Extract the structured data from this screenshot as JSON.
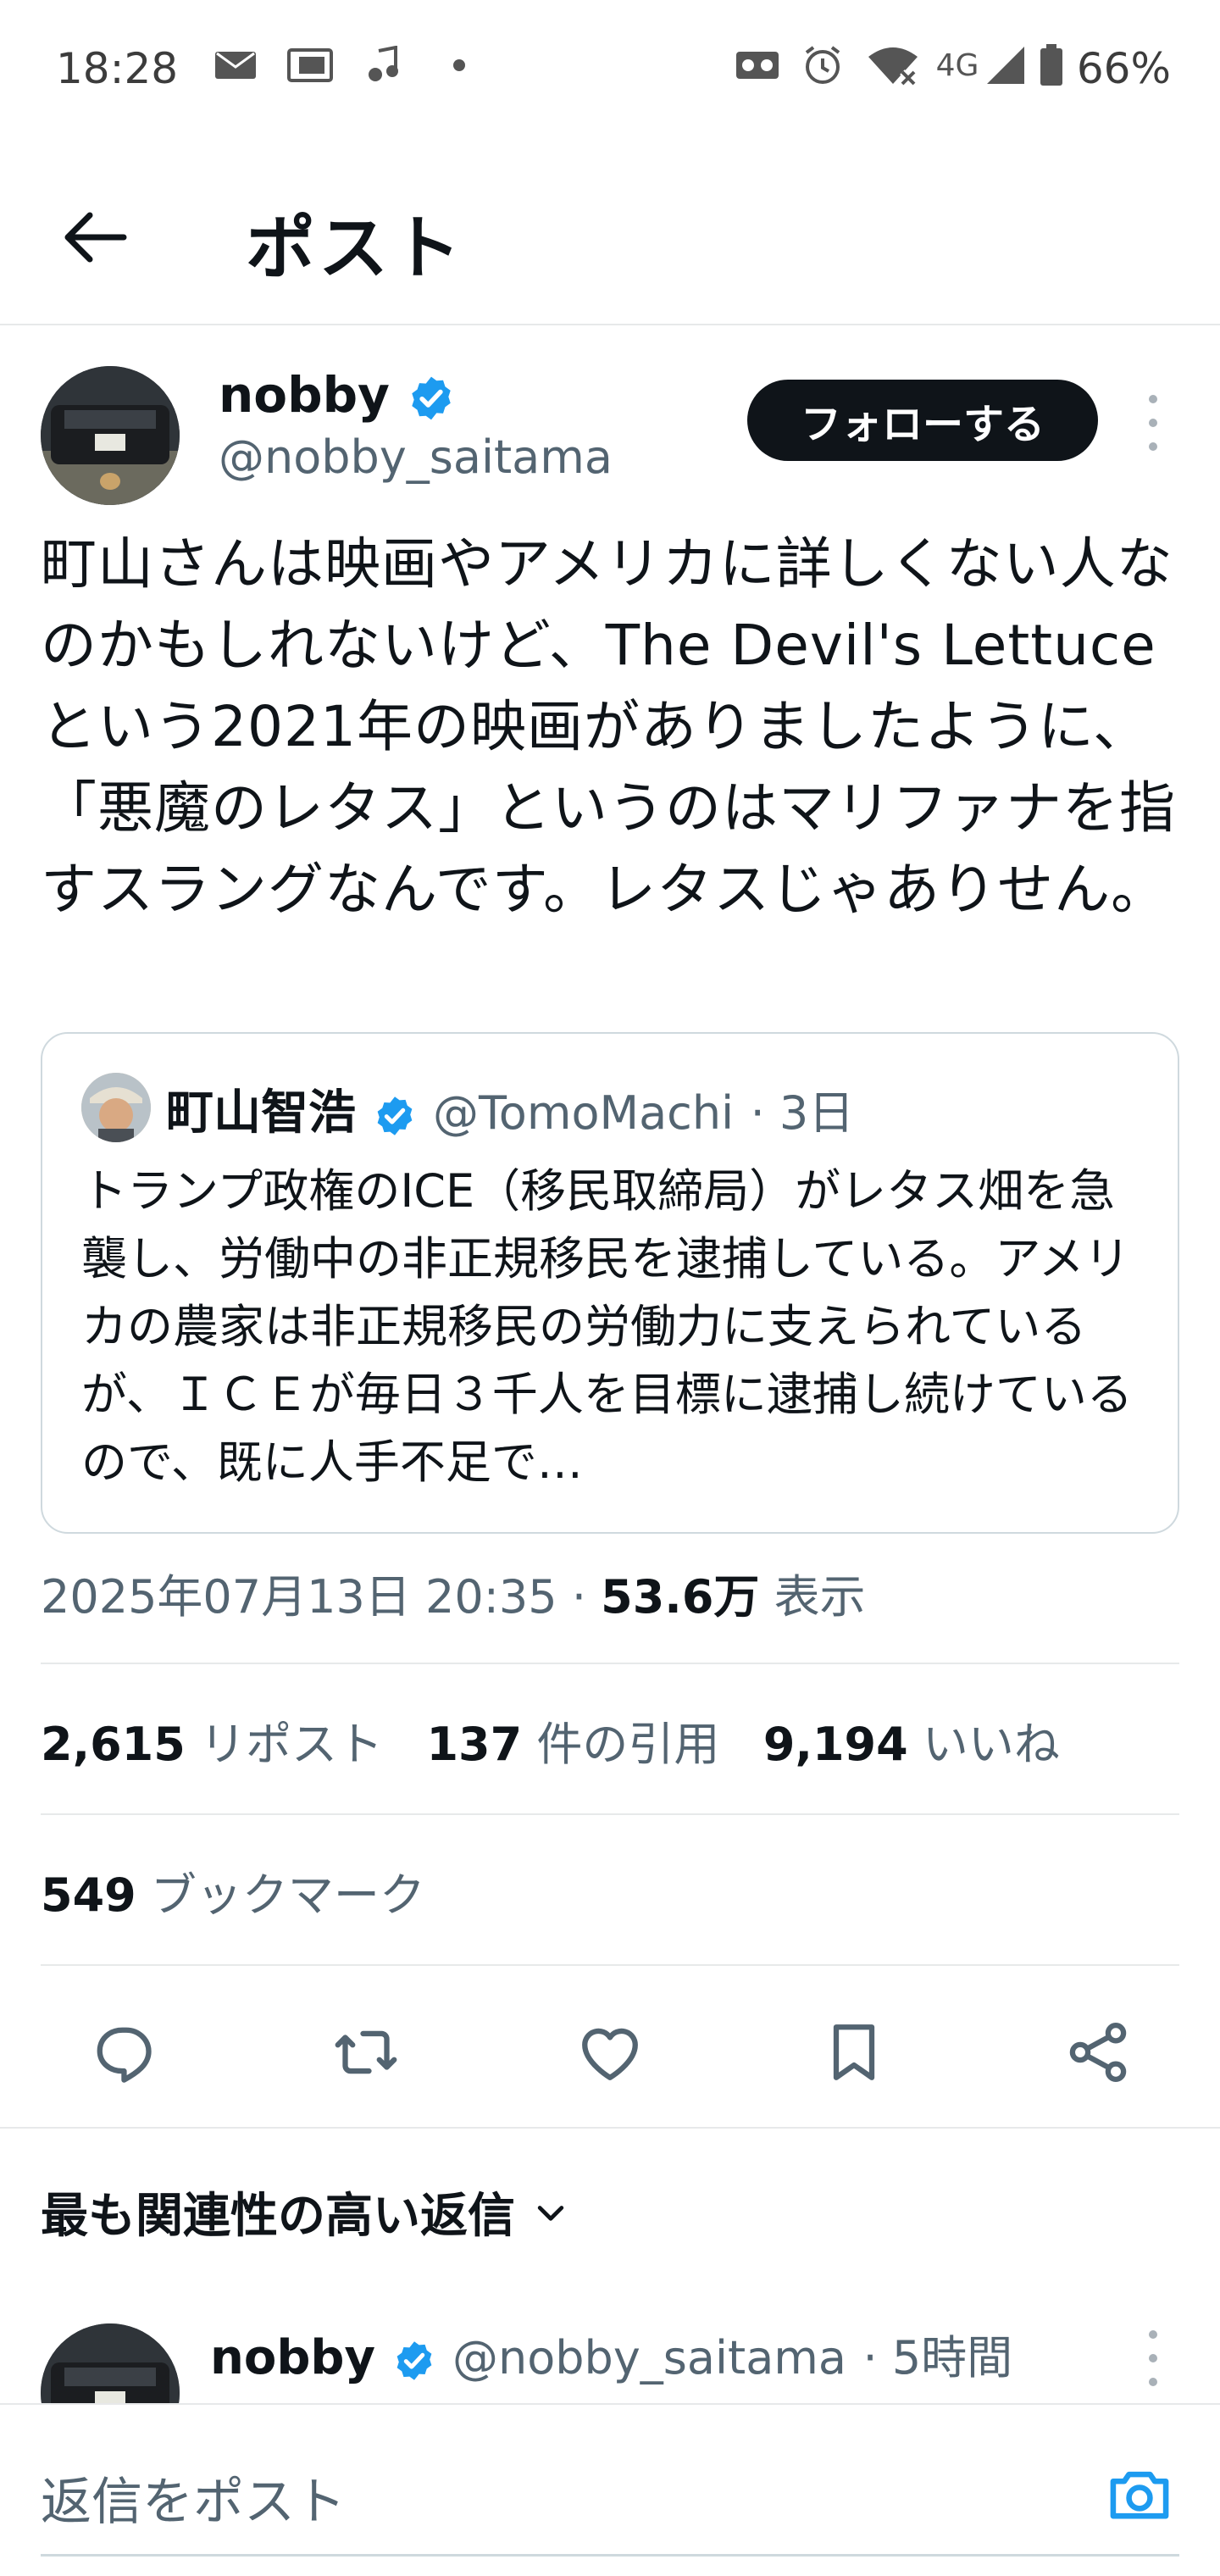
{
  "status_bar": {
    "time": "18:28",
    "network": "4G",
    "battery": "66%",
    "icons": [
      "mail-icon",
      "au-icon",
      "music-icon",
      "dot-icon",
      "cast-icon",
      "alarm-icon",
      "wifi-icon",
      "signal-icon",
      "battery-icon"
    ]
  },
  "header": {
    "title": "ポスト",
    "back_icon": "arrow-left-icon"
  },
  "post": {
    "author_name": "nobby",
    "author_handle": "@nobby_saitama",
    "follow_label": "フォローする",
    "text": "町山さんは映画やアメリカに詳しくない人なのかもしれないけど、The Devil's Lettuceという2021年の映画がありましたように、「悪魔のレタス」というのはマリファナを指すスラングなんです。レタスじゃありせん。",
    "quote": {
      "name": "町山智浩",
      "handle": "@TomoMachi",
      "time": "· 3日",
      "text": "トランプ政権のICE（移民取締局）がレタス畑を急襲し、労働中の非正規移民を逮捕している。アメリカの農家は非正規移民の労働力に支えられているが、ＩＣＥが毎日３千人を目標に逮捕し続けているので、既に人手不足で…"
    },
    "timestamp": "2025年07月13日 20:35",
    "views_count": "53.6万",
    "views_label": "表示",
    "stats": {
      "reposts_count": "2,615",
      "reposts_label": "リポスト",
      "quotes_count": "137",
      "quotes_label": "件の引用",
      "likes_count": "9,194",
      "likes_label": "いいね",
      "bookmarks_count": "549",
      "bookmarks_label": "ブックマーク"
    }
  },
  "actions": [
    "reply-icon",
    "repost-icon",
    "like-icon",
    "bookmark-icon",
    "share-icon"
  ],
  "replies": {
    "sort_label": "最も関連性の高い返信",
    "first_reply": {
      "name": "nobby",
      "handle": "@nobby_saitama",
      "time": "· 5時間"
    }
  },
  "compose": {
    "placeholder": "返信をポスト"
  },
  "colors": {
    "verified_blue": "#1d9bf0",
    "text_primary": "#0f1419",
    "text_secondary": "#536471",
    "border": "#e7e9ea"
  }
}
